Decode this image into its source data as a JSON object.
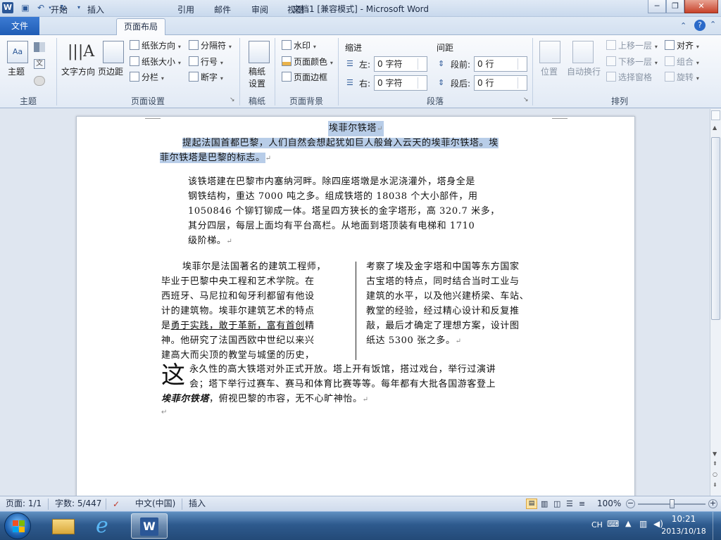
{
  "window": {
    "title": "文档1 [兼容模式] - Microsoft Word",
    "app_icon": "W",
    "quick_access": {
      "save_icon": "save-icon",
      "undo_icon": "undo-icon",
      "redo_icon": "redo-icon"
    },
    "controls": {
      "minimize": "─",
      "restore": "❐",
      "close": "✕"
    }
  },
  "tabs": {
    "file": "文件",
    "items": [
      "开始",
      "插入",
      "页面布局",
      "引用",
      "邮件",
      "审阅",
      "视图"
    ],
    "active_index": 2
  },
  "ribbon": {
    "theme": {
      "themes": "主题",
      "label": "主题"
    },
    "page_setup": {
      "text_direction": "文字方向",
      "margins": "页边距",
      "orientation": "纸张方向",
      "size": "纸张大小",
      "columns": "分栏",
      "breaks": "分隔符",
      "line_numbers": "行号",
      "hyphenation": "断字",
      "label": "页面设置"
    },
    "draft": {
      "paper": "稿纸",
      "setup": "设置",
      "label": "稿纸"
    },
    "page_background": {
      "watermark": "水印",
      "page_color": "页面颜色",
      "page_borders": "页面边框",
      "label": "页面背景"
    },
    "paragraph": {
      "indent_title": "缩进",
      "spacing_title": "间距",
      "left": "左:",
      "right": "右:",
      "before": "段前:",
      "after": "段后:",
      "left_value": "0 字符",
      "right_value": "0 字符",
      "before_value": "0 行",
      "after_value": "0 行",
      "label": "段落"
    },
    "arrange": {
      "position": "位置",
      "wrap_text": "自动换行",
      "bring_forward": "上移一层",
      "send_backward": "下移一层",
      "selection_pane": "选择窗格",
      "align": "对齐",
      "group": "组合",
      "rotate": "旋转",
      "label": "排列"
    }
  },
  "document": {
    "title": "埃菲尔铁塔",
    "para1_line1": "提起法国首都巴黎，人们自然会想起犹如巨人般耸入云天的埃菲尔铁塔。埃",
    "para1_line2": "菲尔铁塔是巴黎的标志。",
    "para2_lines": [
      "该铁塔建在巴黎市内塞纳河畔。除四座塔墩是水泥浇灌外，塔身全是",
      "钢铁结构，重达 7000 吨之多。组成铁塔的 18038 个大小部件，用",
      "1050846 个铆钉铆成一体。塔呈四方狭长的金字塔形，高 320.7 米多，",
      "其分四层，每层上面均有平台高栏。从地面到塔顶装有电梯和 1710",
      "级阶梯。"
    ],
    "col_left_lines": [
      "埃菲尔是法国著名的建筑工程师，",
      "毕业于巴黎中央工程和艺术学院。在",
      "西班牙、马尼拉和匈牙利都留有他设",
      "计的建筑物。埃菲尔建筑艺术的特点",
      "是",
      "勇于实践，敢于革新，富有首创",
      "精",
      "神。他研究了法国西欧中世纪以来兴",
      "建高大而尖顶的教堂与城堡的历史，"
    ],
    "col_right_lines": [
      "考察了埃及金字塔和中国等东方国家",
      "古宝塔的特点，同时结合当时工业与",
      "建筑的水平，以及他兴建桥梁、车站、",
      "教堂的经验，经过精心设计和反复推",
      "敲，最后才确定了理想方案，设计图",
      "纸达 5300 张之多。"
    ],
    "dropcap": "这",
    "para4_line1": "永久性的高大铁塔对外正式开放。塔上开有饭馆，搭过戏台，举行过演讲",
    "para4_line2": "会；塔下举行过赛车、赛马和体育比赛等等。每年都有大批各国游客登上",
    "para4_line3_bold": "埃菲尔铁塔",
    "para4_line3_rest": "，俯视巴黎的市容，无不心旷神怡。"
  },
  "statusbar": {
    "page": "页面: 1/1",
    "words": "字数: 5/447",
    "language": "中文(中国)",
    "mode": "插入",
    "zoom": "100%",
    "zoom_fraction": 0.5
  },
  "taskbar": {
    "lang": "CH",
    "time": "10:21",
    "date": "2013/10/18"
  },
  "colors": {
    "accent": "#2b5797",
    "selection": "#b8cde8",
    "taskbar": "#2e5a8e"
  }
}
